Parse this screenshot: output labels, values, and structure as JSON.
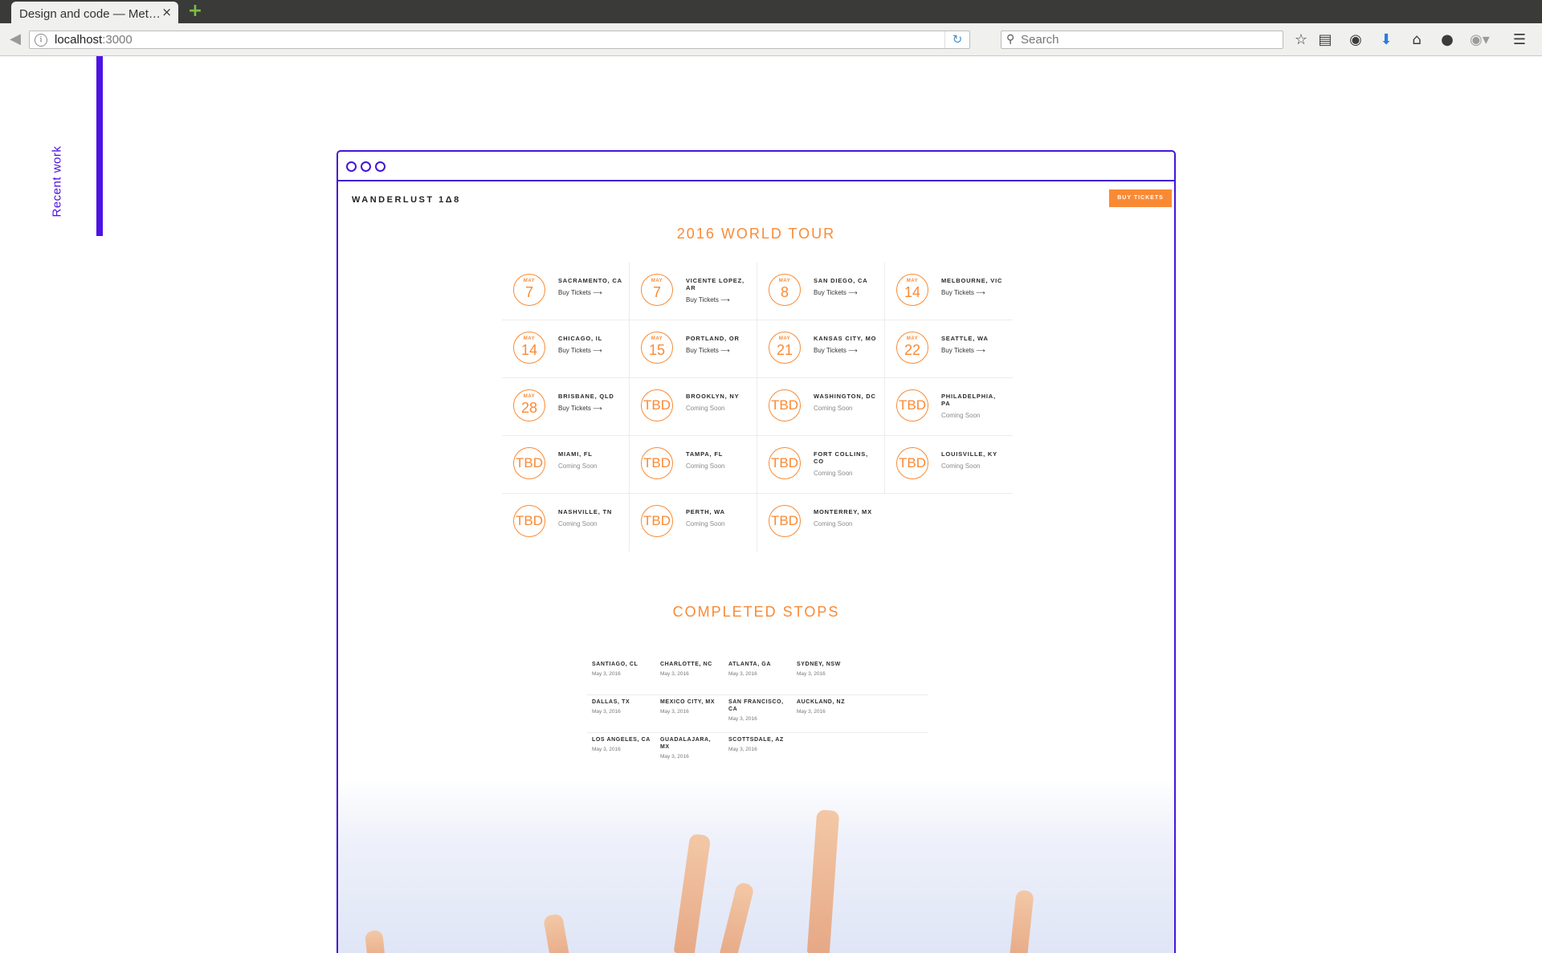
{
  "browser": {
    "tab_title": "Design and code — Met…",
    "tab_close": "×",
    "new_tab": "+",
    "url_host": "localhost",
    "url_port": ":3000",
    "search_placeholder": "Search"
  },
  "page": {
    "side_label": "Recent work",
    "site": {
      "logo": "WANDERLUST 1Δ8",
      "buy_button": "BUY TICKETS",
      "tour_title": "2016 WORLD TOUR",
      "tour_dates": [
        {
          "month": "MAY",
          "day": "7",
          "city": "SACRAMENTO, CA",
          "status": "Buy Tickets ⟶"
        },
        {
          "month": "MAY",
          "day": "7",
          "city": "VICENTE LOPEZ, AR",
          "status": "Buy Tickets ⟶"
        },
        {
          "month": "MAY",
          "day": "8",
          "city": "SAN DIEGO, CA",
          "status": "Buy Tickets ⟶"
        },
        {
          "month": "MAY",
          "day": "14",
          "city": "MELBOURNE, VIC",
          "status": "Buy Tickets ⟶"
        },
        {
          "month": "MAY",
          "day": "14",
          "city": "CHICAGO, IL",
          "status": "Buy Tickets ⟶"
        },
        {
          "month": "MAY",
          "day": "15",
          "city": "PORTLAND, OR",
          "status": "Buy Tickets ⟶"
        },
        {
          "month": "MAY",
          "day": "21",
          "city": "KANSAS CITY, MO",
          "status": "Buy Tickets ⟶"
        },
        {
          "month": "MAY",
          "day": "22",
          "city": "SEATTLE, WA",
          "status": "Buy Tickets ⟶"
        },
        {
          "month": "MAY",
          "day": "28",
          "city": "BRISBANE, QLD",
          "status": "Buy Tickets ⟶"
        },
        {
          "month": "",
          "day": "TBD",
          "city": "BROOKLYN, NY",
          "status": "Coming Soon"
        },
        {
          "month": "",
          "day": "TBD",
          "city": "WASHINGTON, DC",
          "status": "Coming Soon"
        },
        {
          "month": "",
          "day": "TBD",
          "city": "PHILADELPHIA, PA",
          "status": "Coming Soon"
        },
        {
          "month": "",
          "day": "TBD",
          "city": "MIAMI, FL",
          "status": "Coming Soon"
        },
        {
          "month": "",
          "day": "TBD",
          "city": "TAMPA, FL",
          "status": "Coming Soon"
        },
        {
          "month": "",
          "day": "TBD",
          "city": "FORT COLLINS, CO",
          "status": "Coming Soon"
        },
        {
          "month": "",
          "day": "TBD",
          "city": "LOUISVILLE, KY",
          "status": "Coming Soon"
        },
        {
          "month": "",
          "day": "TBD",
          "city": "NASHVILLE, TN",
          "status": "Coming Soon"
        },
        {
          "month": "",
          "day": "TBD",
          "city": "PERTH, WA",
          "status": "Coming Soon"
        },
        {
          "month": "",
          "day": "TBD",
          "city": "MONTERREY, MX",
          "status": "Coming Soon"
        }
      ],
      "completed_title": "COMPLETED STOPS",
      "completed_stops": [
        {
          "city": "SANTIAGO, CL",
          "date": "May 3, 2016"
        },
        {
          "city": "CHARLOTTE, NC",
          "date": "May 3, 2016"
        },
        {
          "city": "ATLANTA, GA",
          "date": "May 3, 2016"
        },
        {
          "city": "SYDNEY, NSW",
          "date": "May 3, 2016"
        },
        {
          "city": "DALLAS, TX",
          "date": "May 3, 2016"
        },
        {
          "city": "MEXICO CITY, MX",
          "date": "May 3, 2016"
        },
        {
          "city": "SAN FRANCISCO, CA",
          "date": "May 3, 2016"
        },
        {
          "city": "AUCKLAND, NZ",
          "date": "May 3, 2016"
        },
        {
          "city": "LOS ANGELES, CA",
          "date": "May 3, 2016"
        },
        {
          "city": "GUADALAJARA, MX",
          "date": "May 3, 2016"
        },
        {
          "city": "SCOTTSDALE, AZ",
          "date": "May 3, 2016"
        }
      ]
    }
  },
  "colors": {
    "accent_purple": "#4d12e6",
    "accent_orange": "#f98a35"
  },
  "icons": [
    "back-arrow-icon",
    "info-icon",
    "reload-icon",
    "search-icon",
    "bookmark-star-icon",
    "reading-list-icon",
    "pocket-icon",
    "download-icon",
    "home-icon",
    "chat-icon",
    "adblock-icon",
    "menu-icon"
  ]
}
